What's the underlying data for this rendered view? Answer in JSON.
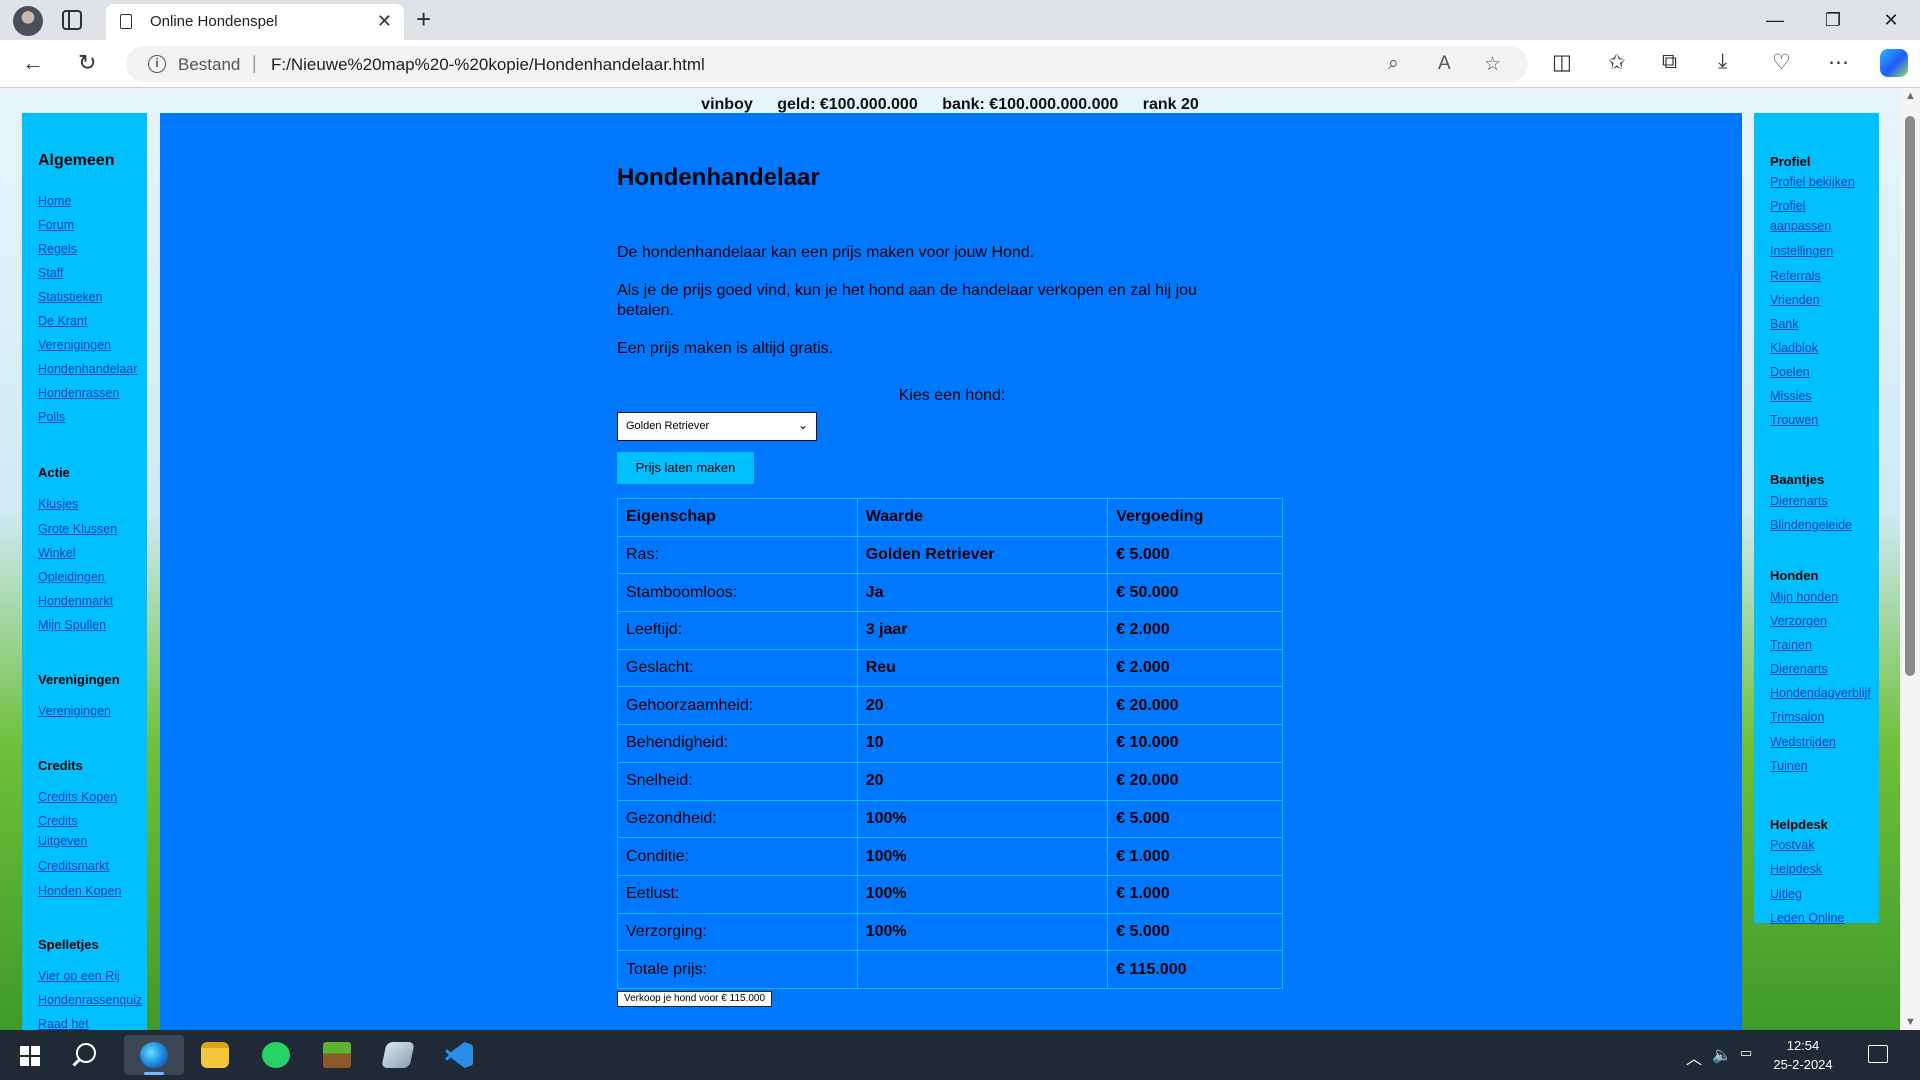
{
  "browser": {
    "tab_title": "Online Hondenspel",
    "url_label": "Bestand",
    "url_separator": "|",
    "url": "F:/Nieuwe%20map%20-%20kopie/Hondenhandelaar.html"
  },
  "topbar": {
    "username": "vinboy",
    "money": "geld: €100.000.000",
    "bank": "bank: €100.000.000.000",
    "rank": "rank 20"
  },
  "left_sidebar": {
    "title": "Algemeen",
    "algemeen": [
      "Home",
      "Forum",
      "Regels",
      "Staff",
      "Statistieken",
      "De Krant",
      "Verenigingen",
      "Hondenhandelaar",
      "Hondenrassen",
      "Polls"
    ],
    "actie_title": "Actie",
    "actie": [
      "Klusjes",
      "Grote Klussen",
      "Winkel",
      "Opleidingen",
      "Hondenmarkt",
      "Mijn Spullen"
    ],
    "verenigingen_title": "Verenigingen",
    "verenigingen": [
      "Verenigingen"
    ],
    "credits_title": "Credits",
    "credits": [
      "Credits Kopen",
      "Credits",
      "Uitgeven",
      "Creditsmarkt",
      "Honden Kopen"
    ],
    "spelletjes_title": "Spelletjes",
    "spelletjes": [
      "Vier op een Rij",
      "Hondenrassenquiz",
      "Raad het"
    ]
  },
  "right_sidebar": {
    "profiel_title": "Profiel",
    "profiel": [
      "Profiel bekijken",
      "Profiel",
      "aanpassen",
      "Instellingen",
      "Referrals",
      "Vrienden",
      "Bank",
      "Kladblok",
      "Doelen",
      "Missies",
      "Trouwen"
    ],
    "baantjes_title": "Baantjes",
    "baantjes": [
      "Dierenarts",
      "Blindengeleide"
    ],
    "honden_title": "Honden",
    "honden": [
      "Mijn honden",
      "Verzorgen",
      "Trainen",
      "Dierenarts",
      "Hondendagverblijf",
      "Trimsalon",
      "Wedstrijden",
      "Tuinen"
    ],
    "helpdesk_title": "Helpdesk",
    "helpdesk": [
      "Postvak",
      "Helpdesk",
      "Uitleg",
      "Leden Online"
    ]
  },
  "main": {
    "title": "Hondenhandelaar",
    "paragraphs": [
      "De hondenhandelaar kan een prijs maken voor jouw Hond.",
      "Als je de prijs goed vind, kun je het hond aan de handelaar verkopen en zal hij jou betalen.",
      "Een prijs maken is altijd gratis."
    ],
    "choose_label": "Kies een hond:",
    "selected_dog": "Golden Retriever",
    "price_button": "Prijs laten maken",
    "table": {
      "headers": [
        "Eigenschap",
        "Waarde",
        "Vergoeding"
      ],
      "rows": [
        [
          "Ras:",
          "Golden Retriever",
          "€ 5.000"
        ],
        [
          "Stamboomloos:",
          "Ja",
          "€ 50.000"
        ],
        [
          "Leeftijd:",
          "3 jaar",
          "€ 2.000"
        ],
        [
          "Geslacht:",
          "Reu",
          "€ 2.000"
        ],
        [
          "Gehoorzaamheid:",
          "20",
          "€ 20.000"
        ],
        [
          "Behendigheid:",
          "10",
          "€ 10.000"
        ],
        [
          "Snelheid:",
          "20",
          "€ 20.000"
        ],
        [
          "Gezondheid:",
          "100%",
          "€ 5.000"
        ],
        [
          "Conditie:",
          "100%",
          "€ 1.000"
        ],
        [
          "Eetlust:",
          "100%",
          "€ 1.000"
        ],
        [
          "Verzorging:",
          "100%",
          "€ 5.000"
        ],
        [
          "Totale prijs:",
          "",
          "€ 115.000"
        ]
      ]
    },
    "sell_button": "Verkoop je hond voor € 115.000"
  },
  "taskbar": {
    "time": "12:54",
    "date": "25-2-2024"
  },
  "colors": {
    "main_bg": "#0077ff",
    "sidebar_bg": "#00c0ff",
    "link": "#123dbf"
  }
}
